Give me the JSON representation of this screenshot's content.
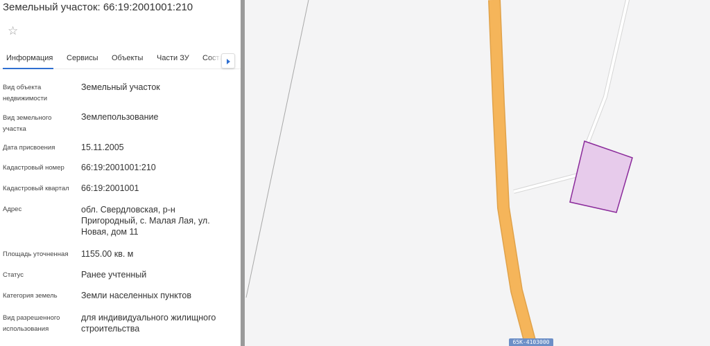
{
  "header": {
    "title": "Земельный участок: 66:19:2001001:210",
    "favorite_icon": "star-outline-icon"
  },
  "tabs": [
    {
      "label": "Информация",
      "active": true
    },
    {
      "label": "Сервисы",
      "active": false
    },
    {
      "label": "Объекты",
      "active": false
    },
    {
      "label": "Части ЗУ",
      "active": false
    },
    {
      "label": "Соста",
      "active": false
    }
  ],
  "tabs_scroll_icon": "chevron-right-icon",
  "info": [
    {
      "label": "Вид объекта недвижимости",
      "value": "Земельный участок"
    },
    {
      "label": "Вид земельного участка",
      "value": "Землепользование"
    },
    {
      "label": "Дата присвоения",
      "value": "15.11.2005"
    },
    {
      "label": "Кадастровый номер",
      "value": "66:19:2001001:210"
    },
    {
      "label": "Кадастровый квартал",
      "value": "66:19:2001001"
    },
    {
      "label": "Адрес",
      "value": "обл. Свердловская, р-н Пригородный, с. Малая Лая, ул. Новая, дом 11"
    },
    {
      "label": "Площадь уточненная",
      "value": "1155.00 кв. м"
    },
    {
      "label": "Статус",
      "value": "Ранее учтенный"
    },
    {
      "label": "Категория земель",
      "value": "Земли населенных пунктов"
    },
    {
      "label": "Вид разрешенного использования",
      "value": "для индивидуального жилищного строительства"
    }
  ],
  "map": {
    "road_label": "65К-4103000",
    "colors": {
      "background": "#f4f4f5",
      "road": "#f5b55a",
      "road_outline": "#e0a24a",
      "parcel_fill": "#e6c6ea",
      "parcel_stroke": "#8a2a9a",
      "road_label_bg": "#6c8fc7"
    }
  }
}
